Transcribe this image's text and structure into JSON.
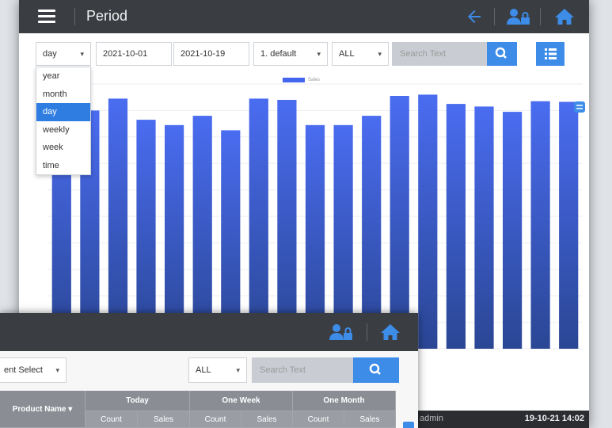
{
  "back_window": {
    "title": "Period",
    "filters": {
      "period_select": "day",
      "date_from": "2021-10-01",
      "date_to": "2021-10-19",
      "sort_select": "1. default",
      "scope_select": "ALL",
      "search_placeholder": "Search Text"
    },
    "period_options": [
      "year",
      "month",
      "day",
      "weekly",
      "week",
      "time"
    ],
    "period_active": "day",
    "legend_label": "Sales",
    "status": {
      "user": "admin",
      "datetime": "19-10-21 14:02"
    }
  },
  "chart_data": {
    "type": "bar",
    "series": [
      {
        "name": "Sales",
        "values": [
          1800,
          1800,
          1890,
          1730,
          1690,
          1760,
          1650,
          1890,
          1880,
          1690,
          1690,
          1760,
          1910,
          1920,
          1850,
          1830,
          1790,
          1870,
          1865
        ]
      }
    ],
    "ylim": [
      0,
      2000
    ],
    "grid": true,
    "legend": "top-center",
    "colors": {
      "bar_top": "#4a6cf0",
      "bar_bottom": "#2a4694"
    }
  },
  "front_window": {
    "filters": {
      "department_select": "ent Select",
      "scope_select": "ALL",
      "search_placeholder": "Search Text"
    },
    "table": {
      "product_header": "Product Name",
      "groups": [
        "Today",
        "One Week",
        "One Month"
      ],
      "sub_columns": [
        "Count",
        "Sales"
      ]
    }
  },
  "colors": {
    "topbar": "#3a3d42",
    "accent_blue": "#3d8ce8",
    "bar_blue": "#4466ee"
  }
}
